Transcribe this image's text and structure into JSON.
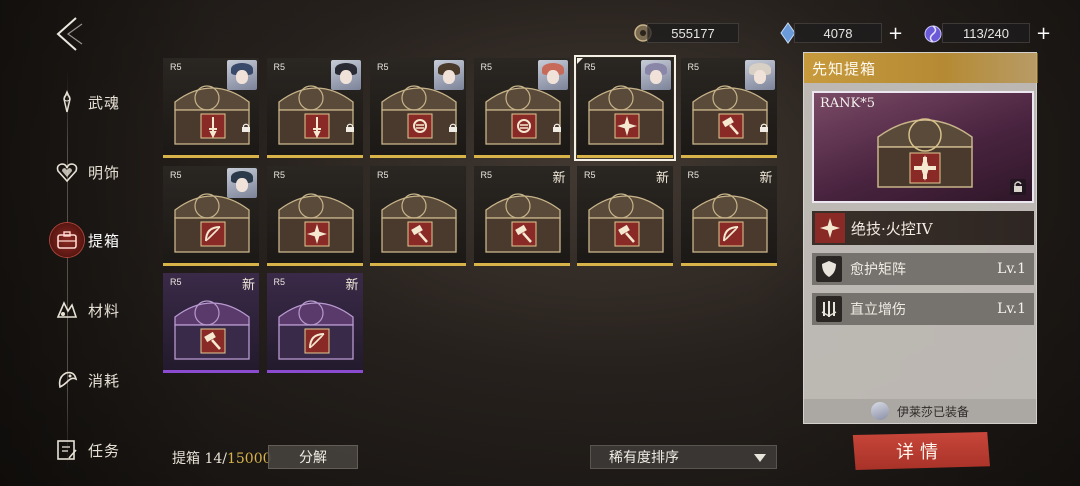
{
  "resources": {
    "gold": {
      "value": "555177",
      "icon": "coin-icon"
    },
    "crystal": {
      "value": "4078",
      "icon": "crystal-icon"
    },
    "stamina": {
      "value": "113/240",
      "icon": "energy-icon"
    }
  },
  "sidebar": {
    "items": [
      {
        "label": "武魂",
        "icon": "spirit-icon"
      },
      {
        "label": "明饰",
        "icon": "heart-ornament-icon"
      },
      {
        "label": "提箱",
        "icon": "case-icon",
        "active": true
      },
      {
        "label": "材料",
        "icon": "material-icon"
      },
      {
        "label": "消耗",
        "icon": "consumable-icon"
      },
      {
        "label": "任务",
        "icon": "task-icon"
      }
    ]
  },
  "grid": {
    "cards": [
      {
        "rank": "R5",
        "emblem": "sword",
        "portrait": "#3a4a6a",
        "locked": true,
        "rarity": "gold"
      },
      {
        "rank": "R5",
        "emblem": "sword",
        "portrait": "#2a2a35",
        "locked": true,
        "rarity": "gold"
      },
      {
        "rank": "R5",
        "emblem": "fist",
        "portrait": "#4a3a2a",
        "locked": true,
        "rarity": "gold"
      },
      {
        "rank": "R5",
        "emblem": "fist",
        "portrait": "#c86a5a",
        "locked": true,
        "rarity": "gold"
      },
      {
        "rank": "R5",
        "emblem": "cross",
        "portrait": "#8a86a8",
        "locked": false,
        "rarity": "gold",
        "selected": true
      },
      {
        "rank": "R5",
        "emblem": "hammer",
        "portrait": "#d8d0c4",
        "locked": true,
        "rarity": "gold"
      },
      {
        "rank": "R5",
        "emblem": "bow",
        "portrait": "#2a3a4a",
        "locked": false,
        "rarity": "gold"
      },
      {
        "rank": "R5",
        "emblem": "cross",
        "locked": false,
        "rarity": "gold"
      },
      {
        "rank": "R5",
        "emblem": "hammer",
        "locked": false,
        "rarity": "gold"
      },
      {
        "rank": "R5",
        "emblem": "hammer",
        "new": "新",
        "locked": false,
        "rarity": "gold"
      },
      {
        "rank": "R5",
        "emblem": "hammer",
        "new": "新",
        "locked": false,
        "rarity": "gold"
      },
      {
        "rank": "R5",
        "emblem": "bow",
        "new": "新",
        "locked": false,
        "rarity": "gold"
      },
      {
        "rank": "R5",
        "emblem": "hammer",
        "new": "新",
        "locked": false,
        "rarity": "purple"
      },
      {
        "rank": "R5",
        "emblem": "bow",
        "new": "新",
        "locked": false,
        "rarity": "purple"
      }
    ]
  },
  "bottom": {
    "count_label": "提箱 14/",
    "count_max": "15000",
    "decompose_label": "分解",
    "sort_label": "稀有度排序"
  },
  "panel": {
    "title": "先知提箱",
    "rank_label": "RANK*5",
    "main_skill": "绝技·火控IV",
    "skills": [
      {
        "name": "愈护矩阵",
        "level": "Lv.1",
        "icon": "shield-icon"
      },
      {
        "name": "直立增伤",
        "level": "Lv.1",
        "icon": "spikes-icon"
      }
    ],
    "equipped_text": "伊莱莎已装备",
    "detail_label": "详情"
  },
  "colors": {
    "accent_gold": "#d8b34a",
    "accent_purple": "#8a4bd0",
    "detail_red": "#c8463a",
    "emblem_red": "#8a2a26"
  }
}
